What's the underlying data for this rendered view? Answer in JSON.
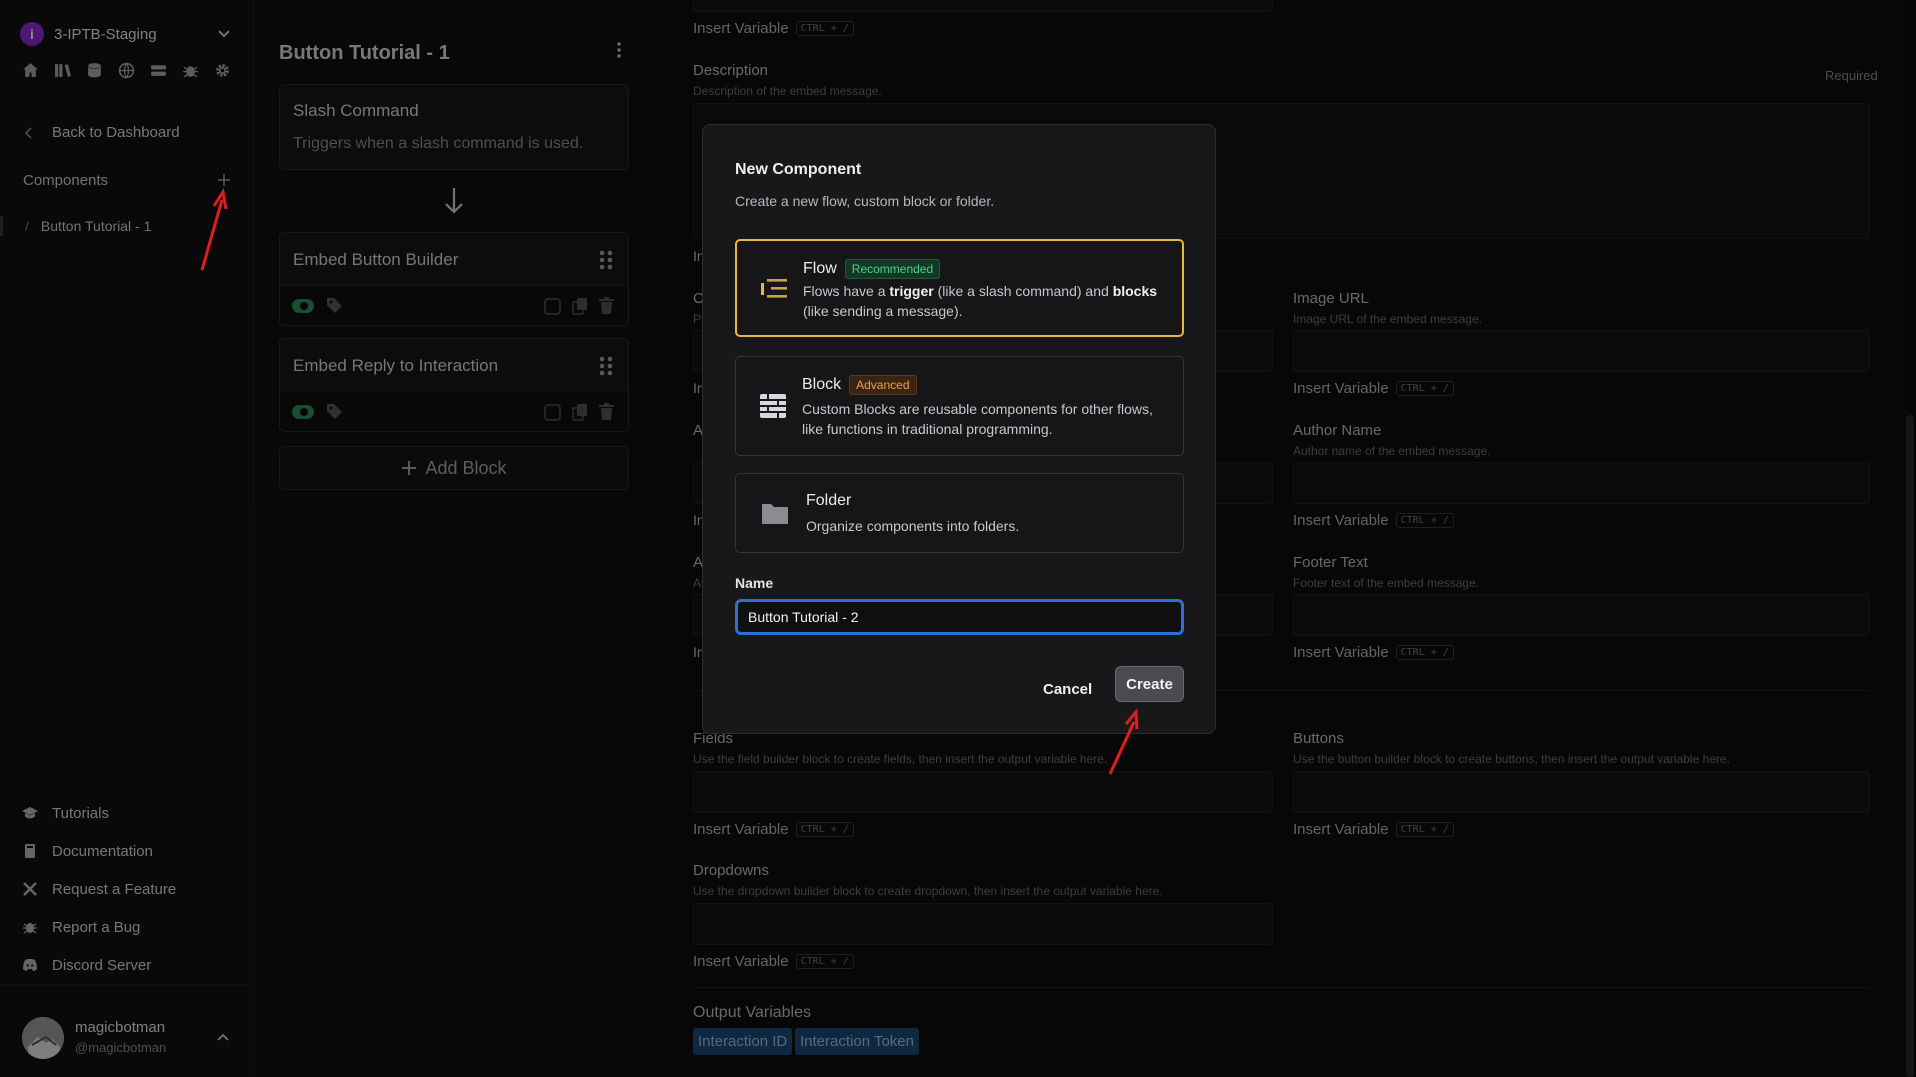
{
  "workspace": {
    "name": "3-IPTB-Staging",
    "logo_letter": "i"
  },
  "icon_bar": [
    "home-icon",
    "library-icon",
    "database-icon",
    "globe-icon",
    "server-icon",
    "bug-icon",
    "gear-icon"
  ],
  "sidebar": {
    "back_label": "Back to Dashboard",
    "components_label": "Components",
    "components": [
      {
        "label": "Button Tutorial - 1",
        "prefix": "/"
      }
    ],
    "nav": [
      {
        "label": "Tutorials",
        "icon": "graduation-cap-icon"
      },
      {
        "label": "Documentation",
        "icon": "book-icon"
      },
      {
        "label": "Request a Feature",
        "icon": "tools-icon"
      },
      {
        "label": "Report a Bug",
        "icon": "bug-icon"
      },
      {
        "label": "Discord Server",
        "icon": "discord-icon"
      }
    ],
    "user": {
      "name": "magicbotman",
      "handle": "@magicbotman"
    }
  },
  "flow": {
    "title": "Button Tutorial - 1",
    "trigger": {
      "title": "Slash Command",
      "desc": "Triggers when a slash command is used."
    },
    "blocks": [
      {
        "title": "Embed Button Builder"
      },
      {
        "title": "Embed Reply to Interaction"
      }
    ],
    "add_block_label": "Add Block"
  },
  "editor": {
    "insert_variable": "Insert Variable",
    "shortcut": "CTRL + /",
    "required": "Required",
    "description": {
      "label": "Description",
      "help": "Description of the embed message."
    },
    "image_url": {
      "label": "Image URL",
      "help": "Image URL of the embed message."
    },
    "author_name": {
      "label": "Author Name",
      "help": "Author name of the embed message."
    },
    "footer_text": {
      "label": "Footer Text",
      "help": "Footer text of the embed message."
    },
    "fields": {
      "label": "Fields",
      "help": "Use the field builder block to create fields, then insert the output variable here."
    },
    "buttons": {
      "label": "Buttons",
      "help": "Use the button builder block to create buttons, then insert the output variable here."
    },
    "dropdowns": {
      "label": "Dropdowns",
      "help": "Use the dropdown builder block to create dropdown, then insert the output variable here."
    },
    "output_variables": {
      "label": "Output Variables",
      "chips": [
        "Interaction ID",
        "Interaction Token"
      ]
    },
    "left_col_fragments": [
      "In",
      "C",
      "Pr",
      "In",
      "A",
      "In",
      "In",
      "A",
      "Au",
      "In"
    ]
  },
  "modal": {
    "title": "New Component",
    "subtitle": "Create a new flow, custom block or folder.",
    "options": [
      {
        "name": "Flow",
        "badge": "Recommended",
        "desc_pre": "Flows have a ",
        "desc_b1": "trigger",
        "desc_mid": " (like a slash command) and ",
        "desc_b2": "blocks",
        "desc_post": " (like sending a message).",
        "selected": true,
        "icon": "flow-icon"
      },
      {
        "name": "Block",
        "badge": "Advanced",
        "desc": "Custom Blocks are reusable components for other flows, like functions in traditional programming.",
        "selected": false,
        "icon": "brick-icon"
      },
      {
        "name": "Folder",
        "badge": "",
        "desc": "Organize components into folders.",
        "selected": false,
        "icon": "folder-icon"
      }
    ],
    "name_label": "Name",
    "name_value": "Button Tutorial - 2",
    "cancel_label": "Cancel",
    "create_label": "Create"
  },
  "colors": {
    "accent_selected": "#e9b73e",
    "input_focus": "#2f6fd6",
    "toggle_on": "#2f8f55",
    "annotation_red": "#e11d1d",
    "chip_bg": "#1d4a74"
  }
}
